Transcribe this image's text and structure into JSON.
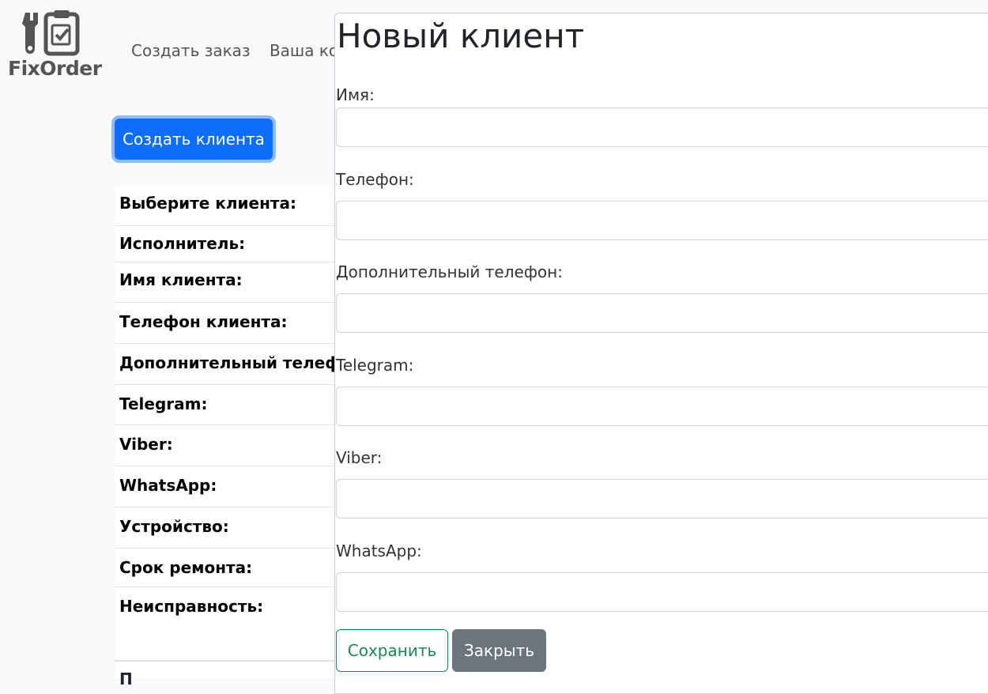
{
  "header": {
    "logo_text": "FixOrder",
    "nav": [
      "Создать заказ",
      "Ваша ком"
    ]
  },
  "create_client_button": "Создать клиента",
  "form_rows": [
    "Выберите клиента:",
    "Исполнитель:",
    "Имя клиента:",
    "Телефон клиента:",
    "Дополнительный телефо",
    "Telegram:",
    "Viber:",
    "WhatsApp:",
    "Устройство:",
    "Срок ремонта:",
    "Неисправность:"
  ],
  "form_bottom_partial": "П",
  "modal": {
    "title": "Новый клиент",
    "fields": [
      {
        "label": "Имя:",
        "value": ""
      },
      {
        "label": "Телефон:",
        "value": ""
      },
      {
        "label": "Дополнительный телефон:",
        "value": ""
      },
      {
        "label": "Telegram:",
        "value": ""
      },
      {
        "label": "Viber:",
        "value": ""
      },
      {
        "label": "WhatsApp:",
        "value": ""
      }
    ],
    "save_button": "Сохранить",
    "close_button": "Закрыть"
  },
  "colors": {
    "primary": "#0d6efd",
    "success": "#198754",
    "secondary": "#6c757d"
  }
}
